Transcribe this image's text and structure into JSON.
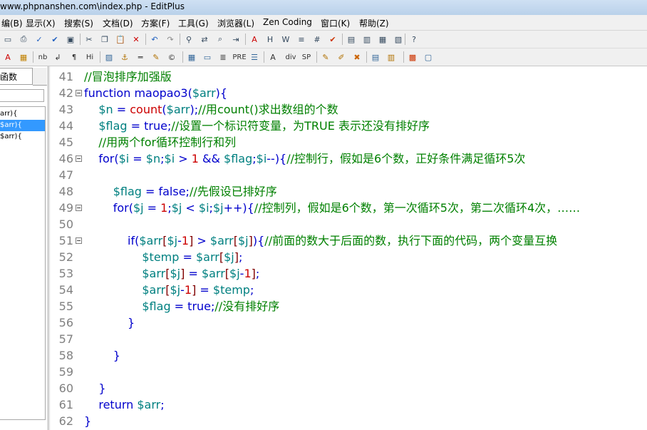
{
  "window": {
    "title": "www.phpnanshen.com\\index.php - EditPlus"
  },
  "menu": [
    "编(B)",
    "显示(X)",
    "搜索(S)",
    "文档(D)",
    "方案(F)",
    "工具(G)",
    "浏览器(L)",
    "Zen Coding",
    "窗口(K)",
    "帮助(Z)"
  ],
  "toolbar1_icons": [
    "new-file-icon",
    "print-icon",
    "spell-check-icon",
    "check-icon",
    "preview-icon",
    "cut-icon",
    "copy-icon",
    "paste-icon",
    "delete-icon",
    "undo-icon",
    "redo-icon",
    "find-icon",
    "replace-icon",
    "find-in-files-icon",
    "goto-line-icon",
    "font-icon",
    "hex-icon",
    "word-wrap-icon",
    "ruler-icon",
    "line-number-icon",
    "spellcheck-mark-icon",
    "window-1-icon",
    "window-2-icon",
    "window-3-icon",
    "window-4-icon",
    "help-icon"
  ],
  "toolbar2": {
    "labels": [
      "nb",
      "¶",
      "Hi",
      "PRE",
      "div",
      "SP"
    ]
  },
  "sidebar": {
    "tab_label": "函数",
    "search_value": "",
    "items": [
      {
        "label": "arr){",
        "selected": false
      },
      {
        "label": "$arr){",
        "selected": true
      },
      {
        "label": "$arr){",
        "selected": false
      }
    ]
  },
  "editor": {
    "lines": [
      {
        "num": "41",
        "fold": false,
        "tokens": [
          [
            "cm",
            "//冒泡排序加强版"
          ]
        ]
      },
      {
        "num": "42",
        "fold": true,
        "tokens": [
          [
            "kw",
            "function "
          ],
          [
            "pl",
            "maopao3("
          ],
          [
            "var",
            "$arr"
          ],
          [
            "pl",
            "){"
          ]
        ]
      },
      {
        "num": "43",
        "fold": false,
        "tokens": [
          [
            "pl",
            "    "
          ],
          [
            "var",
            "$n"
          ],
          [
            "pl",
            " = "
          ],
          [
            "fn",
            "count"
          ],
          [
            "pl",
            "("
          ],
          [
            "var",
            "$arr"
          ],
          [
            "pl",
            ");"
          ],
          [
            "cm",
            "//用"
          ],
          [
            "cm",
            "count()"
          ],
          [
            "cm",
            "求出数组的个数"
          ]
        ]
      },
      {
        "num": "44",
        "fold": false,
        "tokens": [
          [
            "pl",
            "    "
          ],
          [
            "var",
            "$flag"
          ],
          [
            "pl",
            " = "
          ],
          [
            "kw",
            "true"
          ],
          [
            "pl",
            ";"
          ],
          [
            "cm",
            "//设置一个标识符变量，为TRUE 表示还没有排好序"
          ]
        ]
      },
      {
        "num": "45",
        "fold": false,
        "tokens": [
          [
            "pl",
            "    "
          ],
          [
            "cm",
            "//用两个for循环控制行和列"
          ]
        ]
      },
      {
        "num": "46",
        "fold": true,
        "tokens": [
          [
            "pl",
            "    "
          ],
          [
            "kw",
            "for"
          ],
          [
            "pl",
            "("
          ],
          [
            "var",
            "$i"
          ],
          [
            "pl",
            " = "
          ],
          [
            "var",
            "$n"
          ],
          [
            "pl",
            ";"
          ],
          [
            "var",
            "$i"
          ],
          [
            "pl",
            " > "
          ],
          [
            "num",
            "1"
          ],
          [
            "pl",
            " && "
          ],
          [
            "var",
            "$flag"
          ],
          [
            "pl",
            ";"
          ],
          [
            "var",
            "$i"
          ],
          [
            "pl",
            "--){"
          ],
          [
            "cm",
            "//控制行，假如是6个数，正好条件满足循环5次"
          ]
        ]
      },
      {
        "num": "47",
        "fold": false,
        "tokens": []
      },
      {
        "num": "48",
        "fold": false,
        "tokens": [
          [
            "pl",
            "        "
          ],
          [
            "var",
            "$flag"
          ],
          [
            "pl",
            " = "
          ],
          [
            "kw",
            "false"
          ],
          [
            "pl",
            ";"
          ],
          [
            "cm",
            "//先假设已排好序"
          ]
        ]
      },
      {
        "num": "49",
        "fold": true,
        "tokens": [
          [
            "pl",
            "        "
          ],
          [
            "kw",
            "for"
          ],
          [
            "pl",
            "("
          ],
          [
            "var",
            "$j"
          ],
          [
            "pl",
            " = "
          ],
          [
            "num",
            "1"
          ],
          [
            "pl",
            ";"
          ],
          [
            "var",
            "$j"
          ],
          [
            "pl",
            " < "
          ],
          [
            "var",
            "$i"
          ],
          [
            "pl",
            ";"
          ],
          [
            "var",
            "$j"
          ],
          [
            "pl",
            "++){"
          ],
          [
            "cm",
            "//控制列，假如是6个数，第一次循环5次，第二次循环4次，……"
          ]
        ]
      },
      {
        "num": "50",
        "fold": false,
        "tokens": []
      },
      {
        "num": "51",
        "fold": true,
        "tokens": [
          [
            "pl",
            "            "
          ],
          [
            "kw",
            "if"
          ],
          [
            "pl",
            "("
          ],
          [
            "var",
            "$arr"
          ],
          [
            "brk",
            "["
          ],
          [
            "var",
            "$j"
          ],
          [
            "pl",
            "-"
          ],
          [
            "num",
            "1"
          ],
          [
            "brk",
            "]"
          ],
          [
            "pl",
            " > "
          ],
          [
            "var",
            "$arr"
          ],
          [
            "brk",
            "["
          ],
          [
            "var",
            "$j"
          ],
          [
            "brk",
            "]"
          ],
          [
            "pl",
            "){"
          ],
          [
            "cm",
            "//前面的数大于后面的数，执行下面的代码，两个变量互换"
          ]
        ]
      },
      {
        "num": "52",
        "fold": false,
        "tokens": [
          [
            "pl",
            "                "
          ],
          [
            "var",
            "$temp"
          ],
          [
            "pl",
            " = "
          ],
          [
            "var",
            "$arr"
          ],
          [
            "brk",
            "["
          ],
          [
            "var",
            "$j"
          ],
          [
            "brk",
            "]"
          ],
          [
            "pl",
            ";"
          ]
        ]
      },
      {
        "num": "53",
        "fold": false,
        "tokens": [
          [
            "pl",
            "                "
          ],
          [
            "var",
            "$arr"
          ],
          [
            "brk",
            "["
          ],
          [
            "var",
            "$j"
          ],
          [
            "brk",
            "]"
          ],
          [
            "pl",
            " = "
          ],
          [
            "var",
            "$arr"
          ],
          [
            "brk",
            "["
          ],
          [
            "var",
            "$j"
          ],
          [
            "pl",
            "-"
          ],
          [
            "num",
            "1"
          ],
          [
            "brk",
            "]"
          ],
          [
            "pl",
            ";"
          ]
        ]
      },
      {
        "num": "54",
        "fold": false,
        "tokens": [
          [
            "pl",
            "                "
          ],
          [
            "var",
            "$arr"
          ],
          [
            "brk",
            "["
          ],
          [
            "var",
            "$j"
          ],
          [
            "pl",
            "-"
          ],
          [
            "num",
            "1"
          ],
          [
            "brk",
            "]"
          ],
          [
            "pl",
            " = "
          ],
          [
            "var",
            "$temp"
          ],
          [
            "pl",
            ";"
          ]
        ]
      },
      {
        "num": "55",
        "fold": false,
        "tokens": [
          [
            "pl",
            "                "
          ],
          [
            "var",
            "$flag"
          ],
          [
            "pl",
            " = "
          ],
          [
            "kw",
            "true"
          ],
          [
            "pl",
            ";"
          ],
          [
            "cm",
            "//没有排好序"
          ]
        ]
      },
      {
        "num": "56",
        "fold": false,
        "tokens": [
          [
            "pl",
            "            }"
          ]
        ]
      },
      {
        "num": "57",
        "fold": false,
        "tokens": []
      },
      {
        "num": "58",
        "fold": false,
        "tokens": [
          [
            "pl",
            "        }"
          ]
        ]
      },
      {
        "num": "59",
        "fold": false,
        "tokens": []
      },
      {
        "num": "60",
        "fold": false,
        "tokens": [
          [
            "pl",
            "    }"
          ]
        ]
      },
      {
        "num": "61",
        "fold": false,
        "tokens": [
          [
            "pl",
            "    "
          ],
          [
            "kw",
            "return "
          ],
          [
            "var",
            "$arr"
          ],
          [
            "pl",
            ";"
          ]
        ]
      },
      {
        "num": "62",
        "fold": false,
        "tokens": [
          [
            "pl",
            "}"
          ]
        ]
      }
    ]
  }
}
